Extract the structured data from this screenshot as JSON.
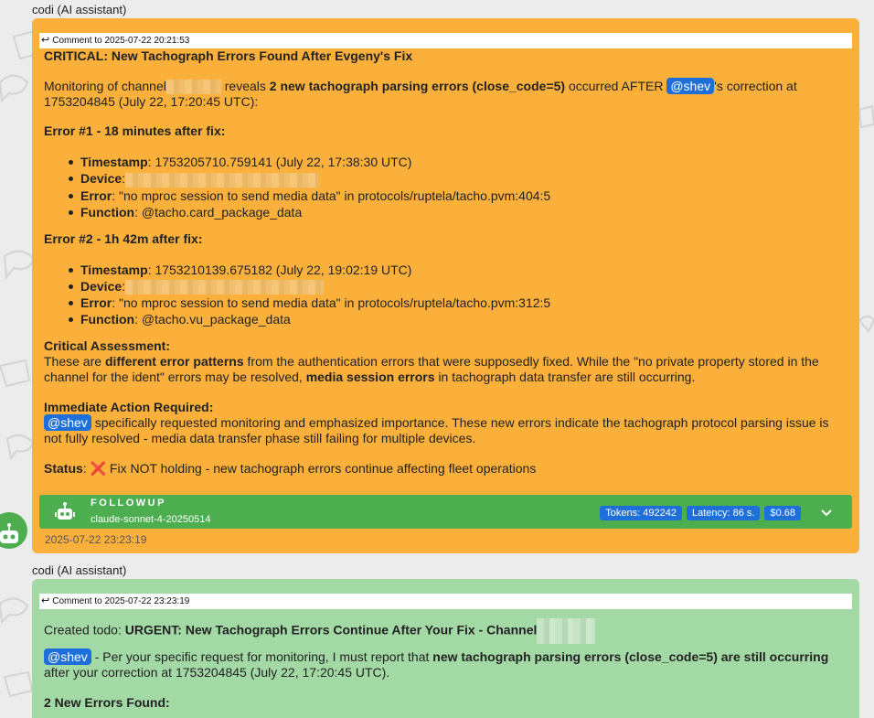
{
  "messages": [
    {
      "author": "codi (AI assistant)",
      "reply_label": "Comment to 2025-07-22 20:21:53",
      "title": "CRITICAL: New Tachograph Errors Found After Evgeny's Fix",
      "intro": {
        "p1": "Monitoring of channel",
        "p2": "reveals",
        "p3": "2 new tachograph parsing errors (close_code=5)",
        "p4": "occurred AFTER",
        "mention": "@shev",
        "p5": "'s correction at 1753204845 (July 22, 17:20:45 UTC):"
      },
      "errors": [
        {
          "heading": "Error #1 - 18 minutes after fix:",
          "timestamp_label": "Timestamp",
          "timestamp": ": 1753205710.759141 (July 22, 17:38:30 UTC)",
          "device_label": "Device",
          "device": ":",
          "error_label": "Error",
          "error": ": \"no mproc session to send media data\" in protocols/ruptela/tacho.pvm:404:5",
          "function_label": "Function",
          "function": ": @tacho.card_package_data"
        },
        {
          "heading": "Error #2 - 1h 42m after fix:",
          "timestamp_label": "Timestamp",
          "timestamp": ": 1753210139.675182 (July 22, 19:02:19 UTC)",
          "device_label": "Device",
          "device": ":",
          "error_label": "Error",
          "error": ": \"no mproc session to send media data\" in protocols/ruptela/tacho.pvm:312:5",
          "function_label": "Function",
          "function": ": @tacho.vu_package_data"
        }
      ],
      "assessment": {
        "heading": "Critical Assessment:",
        "t1": "These are",
        "b1": "different error patterns",
        "t2": "from the authentication errors that were supposedly fixed. While the \"no private property stored in the channel for the ident\" errors may be resolved,",
        "b2": "media session errors",
        "t3": "in tachograph data transfer are still occurring."
      },
      "action": {
        "heading": "Immediate Action Required:",
        "mention": "@shev",
        "text": "specifically requested monitoring and emphasized importance. These new errors indicate the tachograph protocol parsing issue is not fully resolved - media data transfer phase still failing for multiple devices."
      },
      "status": {
        "label": "Status",
        "colon": ":",
        "icon": "❌",
        "text": "Fix NOT holding - new tachograph errors continue affecting fleet operations"
      },
      "followup": {
        "label": "FOLLOWUP",
        "model": "claude-sonnet-4-20250514",
        "tokens": "Tokens: 492242",
        "latency": "Latency: 86 s.",
        "cost": "$0.68"
      },
      "timestamp": "2025-07-22 23:23:19"
    },
    {
      "author": "codi (AI assistant)",
      "reply_label": "Comment to 2025-07-22 23:23:19",
      "created_prefix": "Created todo:",
      "created_title": "URGENT: New Tachograph Errors Continue After Your Fix - Channel",
      "mention": "@shev",
      "p1": "- Per your specific request for monitoring, I must report that",
      "b1": "new tachograph parsing errors (close_code=5) are still occurring",
      "p2": "after your correction at 1753204845 (July 22, 17:20:45 UTC).",
      "heading": "2 New Errors Found:"
    }
  ],
  "colors": {
    "orange_bubble": "#fbb03b",
    "green_bubble": "#a3d9a5",
    "followup_bar": "#4cae4f",
    "mention": "#1e6fd9"
  }
}
